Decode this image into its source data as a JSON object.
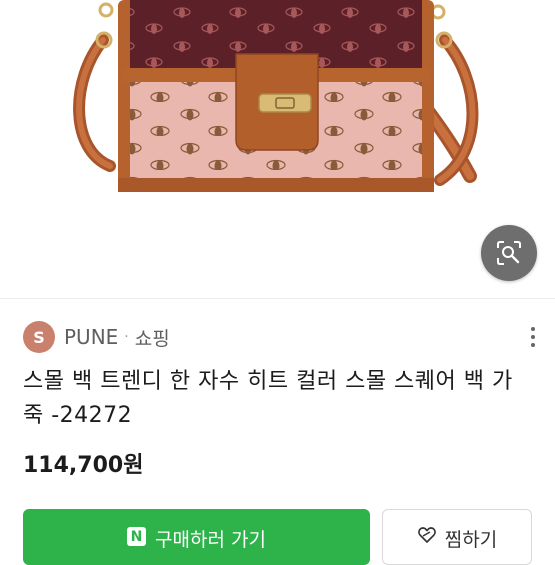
{
  "product": {
    "image_alt": "bag product image"
  },
  "seller": {
    "avatar_letter": "S",
    "name": "PUNE",
    "separator": "·",
    "category": "쇼핑"
  },
  "listing": {
    "title": "스몰 백 트렌디 한 자수 히트 컬러 스몰 스퀘어 백 가죽 -24272",
    "price": "114,700원"
  },
  "actions": {
    "npay_badge": "N",
    "buy_label": "구매하러 가기",
    "wish_label": "찜하기"
  },
  "colors": {
    "accent_green": "#2db34a",
    "avatar": "#c9806d"
  }
}
